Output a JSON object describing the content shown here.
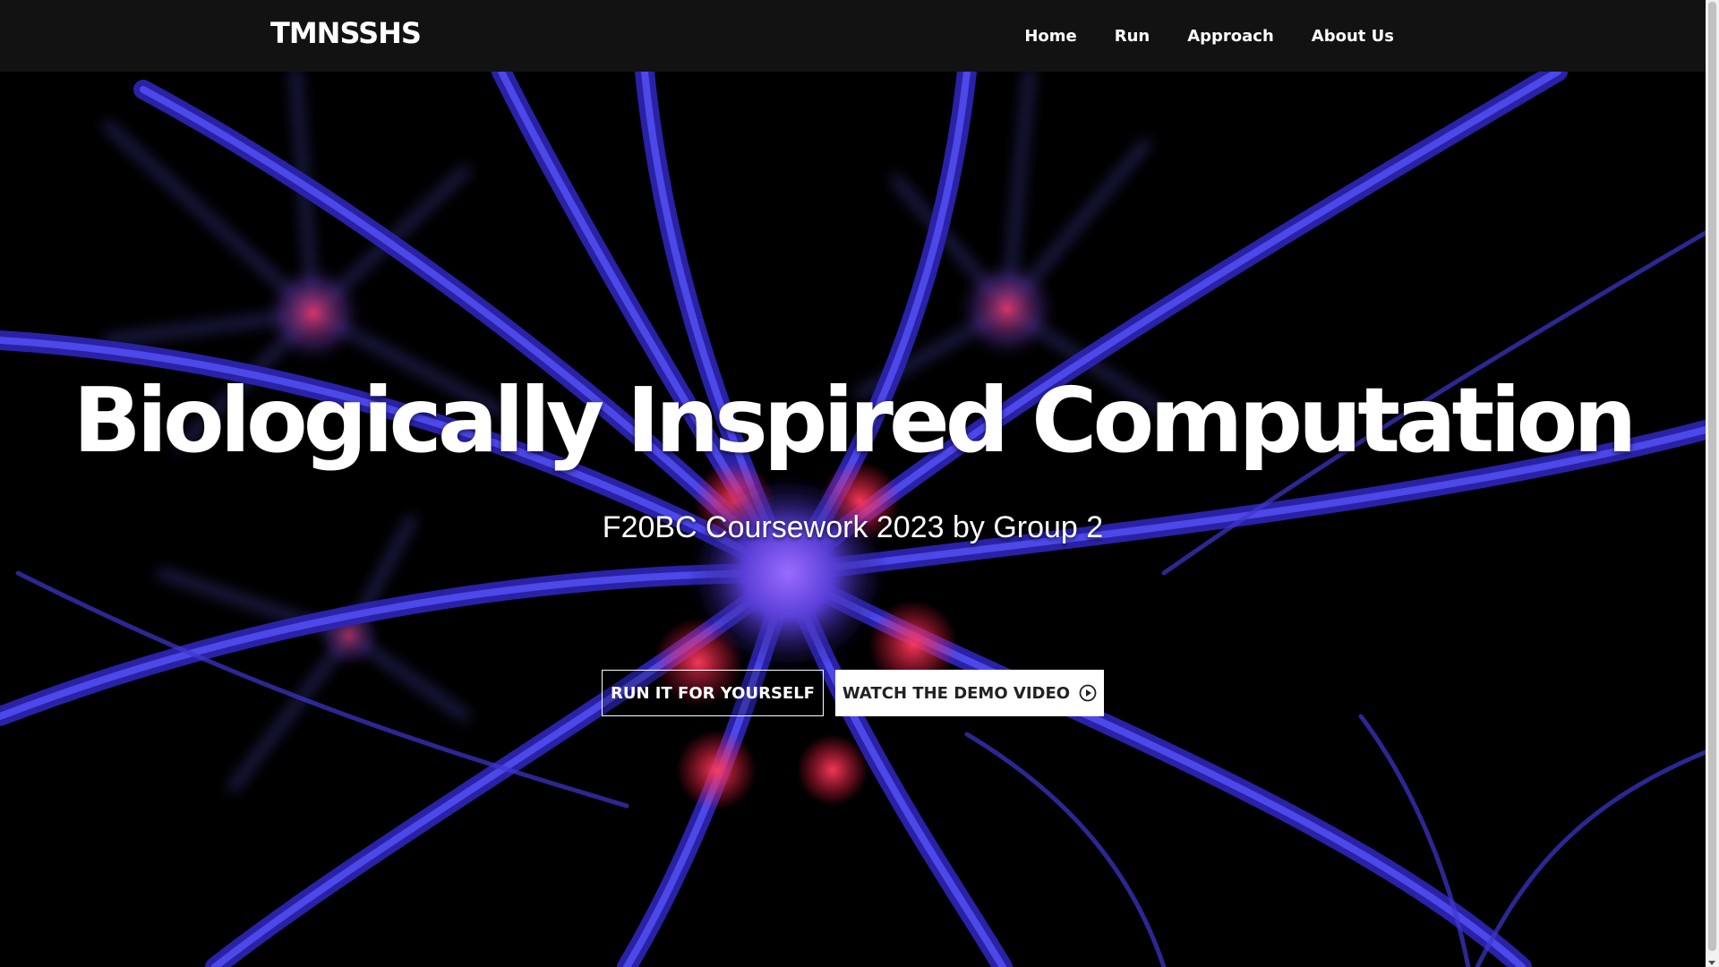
{
  "navbar": {
    "brand": "TMNSSHS",
    "links": [
      {
        "label": "Home"
      },
      {
        "label": "Run"
      },
      {
        "label": "Approach"
      },
      {
        "label": "About Us"
      }
    ]
  },
  "hero": {
    "title": "Biologically Inspired Computation",
    "subtitle": "F20BC Coursework 2023 by Group 2",
    "primary_button": "RUN IT FOR YOURSELF",
    "secondary_button": "WATCH THE DEMO VIDEO",
    "secondary_button_icon": "play-circle-icon",
    "background_image": "neuron-illustration"
  },
  "colors": {
    "navbar_bg": "#121212",
    "neuron_blue": "#3a2fd8",
    "neuron_highlight": "#ff2a55",
    "text": "#ffffff",
    "button_solid_bg": "#ffffff"
  }
}
